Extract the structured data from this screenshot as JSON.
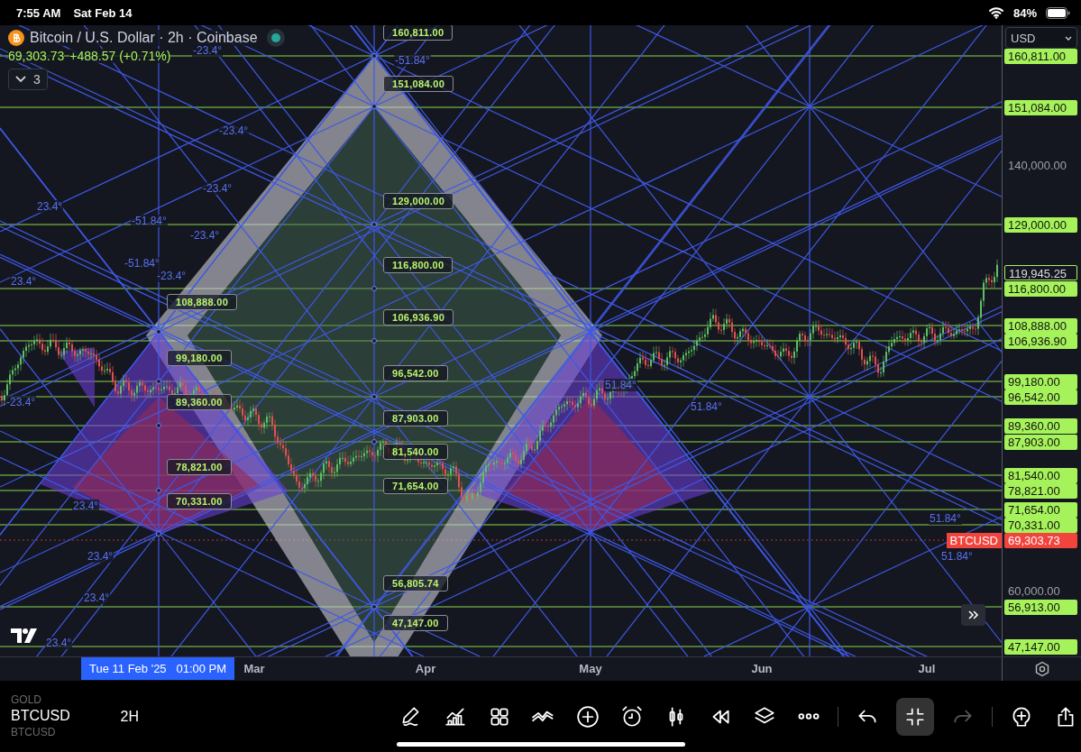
{
  "status_bar": {
    "time": "7:55 AM",
    "date": "Sat Feb 14",
    "battery": "84%"
  },
  "header": {
    "title": "Bitcoin / U.S. Dollar · 2h · Coinbase",
    "market_open": true,
    "price": "69,303.73",
    "change": "+488.57 (+0.71%)",
    "indicators_toggle": {
      "count": "3",
      "expanded": false
    }
  },
  "currency": "USD",
  "price_axis": [
    {
      "text": "160,811.00",
      "kind": "level"
    },
    {
      "text": "151,084.00",
      "kind": "level"
    },
    {
      "text": "140,000.00",
      "kind": "plain"
    },
    {
      "text": "129,000.00",
      "kind": "level"
    },
    {
      "text": "119,945.25",
      "kind": "current"
    },
    {
      "text": "116,800.00",
      "kind": "level"
    },
    {
      "text": "108,888.00",
      "kind": "level"
    },
    {
      "text": "106,936.90",
      "kind": "level"
    },
    {
      "text": "99,180.00",
      "kind": "level"
    },
    {
      "text": "96,542.00",
      "kind": "level"
    },
    {
      "text": "89,360.00",
      "kind": "level"
    },
    {
      "text": "87,903.00",
      "kind": "level"
    },
    {
      "text": "81,540.00",
      "kind": "level"
    },
    {
      "text": "78,821.00",
      "kind": "level"
    },
    {
      "text": "71,654.00",
      "kind": "level"
    },
    {
      "text": "70,331.00",
      "kind": "level"
    },
    {
      "text": "69,303.73",
      "kind": "last",
      "tag": "BTCUSD"
    },
    {
      "text": "60,000.00",
      "kind": "plain"
    },
    {
      "text": "56,913.00",
      "kind": "level"
    },
    {
      "text": "47,147.00",
      "kind": "level"
    }
  ],
  "callouts": [
    {
      "text": "160,811.00",
      "kind": "center"
    },
    {
      "text": "151,084.00",
      "kind": "center"
    },
    {
      "text": "129,000.00",
      "kind": "center"
    },
    {
      "text": "116,800.00",
      "kind": "center"
    },
    {
      "text": "108,888.00",
      "kind": "left"
    },
    {
      "text": "106,936.90",
      "kind": "center"
    },
    {
      "text": "99,180.00",
      "kind": "left"
    },
    {
      "text": "96,542.00",
      "kind": "center"
    },
    {
      "text": "89,360.00",
      "kind": "left"
    },
    {
      "text": "87,903.00",
      "kind": "center"
    },
    {
      "text": "81,540.00",
      "kind": "center"
    },
    {
      "text": "78,821.00",
      "kind": "left"
    },
    {
      "text": "71,654.00",
      "kind": "center"
    },
    {
      "text": "70,331.00",
      "kind": "left"
    },
    {
      "text": "56,805.74",
      "kind": "center"
    },
    {
      "text": "47,147.00",
      "kind": "center"
    }
  ],
  "angle_labels": [
    "-23.4°",
    "-51.84°",
    "-23.4°",
    "-23.4°",
    "23.4°",
    "-51.84°",
    "-23.4°",
    "-51.84°",
    "-23.4°",
    "23.4°",
    "-23.4°",
    "51.84°",
    "51.84°",
    "23.4°",
    "23.4°",
    "23.4°",
    "23.4°",
    "51.84°",
    "51.84°"
  ],
  "time_axis": {
    "cursor_label": "Tue 11 Feb '25   01:00 PM",
    "months": [
      "Mar",
      "Apr",
      "May",
      "Jun",
      "Jul"
    ]
  },
  "symbol_picker": [
    {
      "text": "GOLD",
      "selected": false
    },
    {
      "text": "BTCUSD",
      "selected": true
    },
    {
      "text": "BTCUSD",
      "selected": false
    }
  ],
  "interval": "2H",
  "toolbar": [
    {
      "kind": "pen",
      "on": false,
      "disabled": false
    },
    {
      "kind": "indicators",
      "on": false,
      "disabled": false
    },
    {
      "kind": "grid",
      "on": false,
      "disabled": false
    },
    {
      "kind": "trend-lines",
      "on": false,
      "disabled": false
    },
    {
      "kind": "add",
      "on": false,
      "disabled": false
    },
    {
      "kind": "alert",
      "on": false,
      "disabled": false
    },
    {
      "kind": "candles",
      "on": false,
      "disabled": false
    },
    {
      "kind": "replay",
      "on": false,
      "disabled": false
    },
    {
      "kind": "layers",
      "on": false,
      "disabled": false
    },
    {
      "kind": "more",
      "on": false,
      "disabled": false
    },
    {
      "kind": "divider"
    },
    {
      "kind": "undo",
      "on": false,
      "disabled": false
    },
    {
      "kind": "collapse",
      "on": true,
      "disabled": false
    },
    {
      "kind": "redo",
      "on": false,
      "disabled": true
    },
    {
      "kind": "divider"
    },
    {
      "kind": "idea",
      "on": false,
      "disabled": false
    },
    {
      "kind": "share",
      "on": false,
      "disabled": false
    }
  ]
}
